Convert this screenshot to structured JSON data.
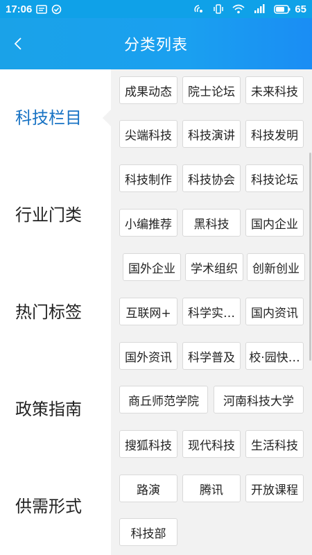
{
  "status_bar": {
    "time": "17:06",
    "battery": "65",
    "left_icons": [
      "message-icon",
      "check-circle-icon"
    ],
    "right_icons": [
      "nfc-icon",
      "vibrate-icon",
      "wifi-icon",
      "signal-icon",
      "battery-icon"
    ]
  },
  "header": {
    "title": "分类列表",
    "back_icon": "chevron-left-icon"
  },
  "sidebar": {
    "items": [
      {
        "label": "科技栏目"
      },
      {
        "label": "行业门类"
      },
      {
        "label": "热门标签"
      },
      {
        "label": "政策指南"
      },
      {
        "label": "供需形式"
      }
    ],
    "active_index": 0
  },
  "tags": [
    "成果动态",
    "院士论坛",
    "未来科技",
    "尖端科技",
    "科技演讲",
    "科技发明",
    "科技制作",
    "科技协会",
    "科技论坛",
    "小编推荐",
    "黑科技",
    "国内企业",
    "国外企业",
    "学术组织",
    "创新创业",
    "互联网+",
    "科学实…",
    "国内资讯",
    "国外资讯",
    "科学普及",
    "校·园快…",
    "商丘师范学院",
    "河南科技大学",
    "搜狐科技",
    "现代科技",
    "生活科技",
    "路演",
    "腾讯",
    "开放课程",
    "科技部"
  ],
  "colors": {
    "header_start": "#1aa2e8",
    "header_end": "#1a8df4",
    "active_text": "#1873c4",
    "panel_bg": "#f2f2f2"
  }
}
